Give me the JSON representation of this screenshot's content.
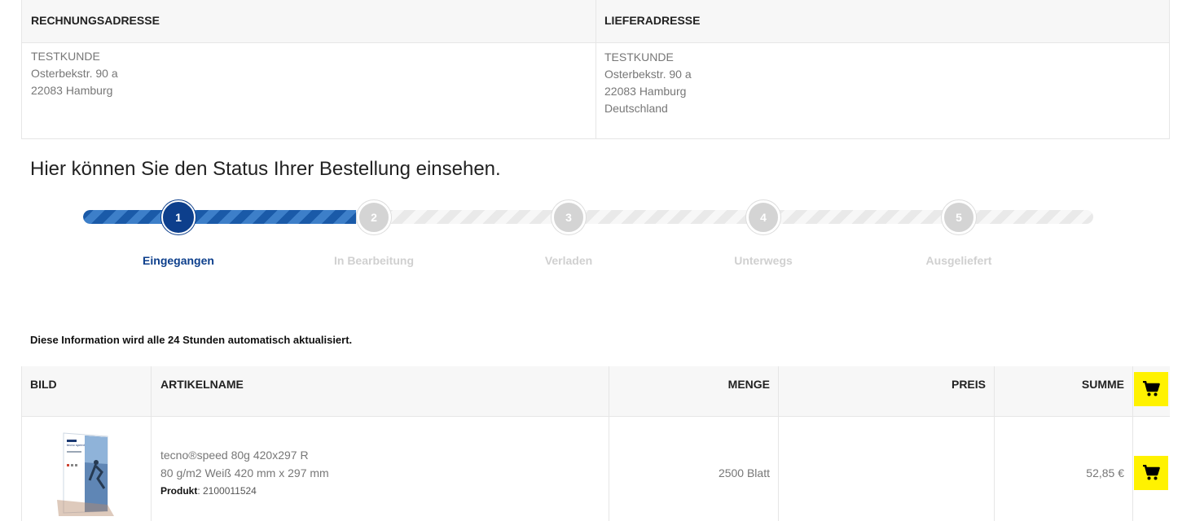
{
  "billing": {
    "heading": "RECHNUNGSADRESSE",
    "lines": [
      "TESTKUNDE",
      "Osterbekstr. 90 a",
      "22083 Hamburg"
    ]
  },
  "shipping": {
    "heading": "LIEFERADRESSE",
    "lines": [
      "TESTKUNDE",
      "Osterbekstr. 90 a",
      "22083 Hamburg",
      "Deutschland"
    ]
  },
  "status": {
    "title": "Hier können Sie den Status Ihrer Bestellung einsehen.",
    "progress": 0.27,
    "steps": [
      {
        "number": "1",
        "label": "Eingegangen",
        "active": true
      },
      {
        "number": "2",
        "label": "In Bearbeitung",
        "active": false
      },
      {
        "number": "3",
        "label": "Verladen",
        "active": false
      },
      {
        "number": "4",
        "label": "Unterwegs",
        "active": false
      },
      {
        "number": "5",
        "label": "Ausgeliefert",
        "active": false
      }
    ],
    "info": "Diese Information wird alle 24 Stunden automatisch aktualisiert."
  },
  "items_table": {
    "headers": {
      "image": "BILD",
      "name": "ARTIKELNAME",
      "qty": "MENGE",
      "price": "PREIS",
      "sum": "SUMME"
    },
    "rows": [
      {
        "name": "tecno®speed 80g 420x297 R",
        "desc": "80 g/m2 Weiß 420 mm x 297 mm",
        "product_label": "Produkt",
        "product_no": ": 2100011524",
        "qty": "2500 Blatt",
        "price": "",
        "sum": "52,85 €",
        "image_text": "tecno speed"
      }
    ]
  },
  "colors": {
    "accent": "#0d3f8c",
    "cart_button": "#fff200"
  },
  "icons": {
    "cart": "shopping-cart-icon"
  }
}
